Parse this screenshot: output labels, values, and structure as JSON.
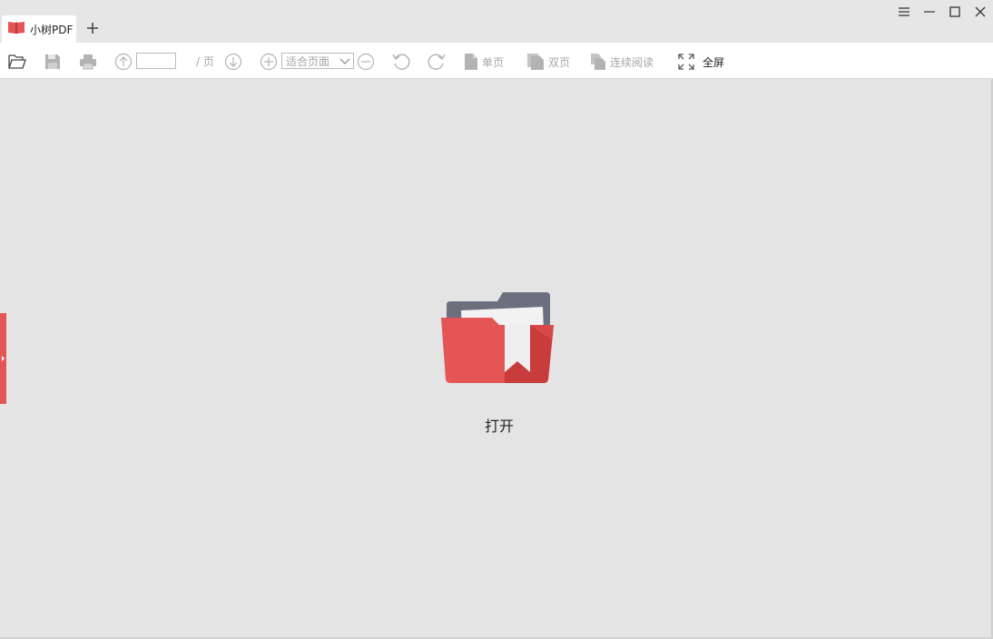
{
  "app": {
    "tab_title": "小树PDF",
    "logo_icon": "red-book-icon"
  },
  "window_controls": [
    "menu-icon",
    "minimize-icon",
    "maximize-icon",
    "close-icon"
  ],
  "toolbar": {
    "page_input_value": "",
    "page_suffix": "/ 页",
    "zoom_value": "适合页面",
    "single_page_label": "单页",
    "double_page_label": "双页",
    "continuous_label": "连续阅读",
    "fullscreen_label": "全屏"
  },
  "main": {
    "open_label": "打开"
  },
  "colors": {
    "accent": "#e45555",
    "folder_dark": "#6b6f7e",
    "folder_red": "#e45555",
    "folder_red_dark": "#c83c3c"
  }
}
